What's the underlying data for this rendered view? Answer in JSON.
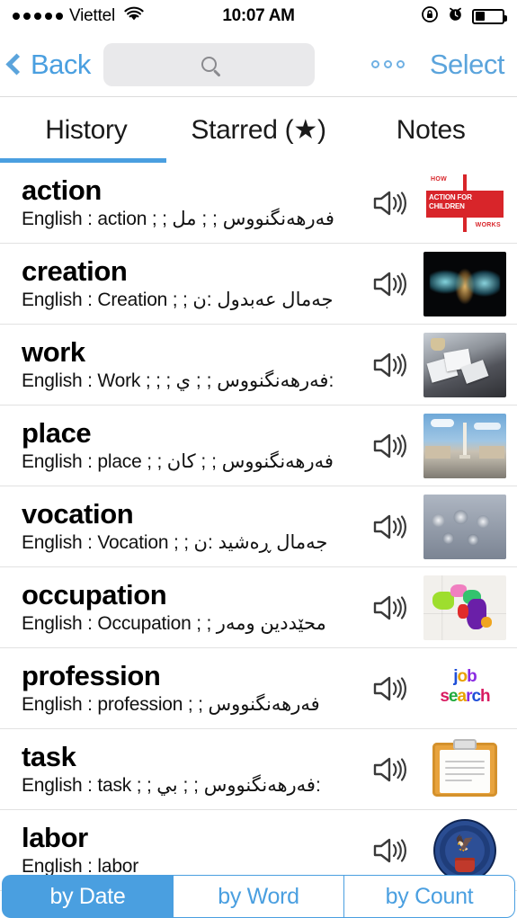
{
  "statusbar": {
    "carrier": "Viettel",
    "time": "10:07 AM",
    "signal_dots": 5,
    "wifi_icon": "wifi-icon",
    "rotation_lock_icon": "rotation-lock-icon",
    "alarm_icon": "alarm-clock-icon",
    "battery_icon": "battery-icon",
    "battery_percent": 35
  },
  "navbar": {
    "back_label": "Back",
    "back_icon": "chevron-left-icon",
    "search_placeholder": "",
    "search_value": "",
    "search_icon": "search-icon",
    "more_icon": "more-options-icon",
    "select_label": "Select"
  },
  "tabs": {
    "items": [
      {
        "label": "History",
        "active": true
      },
      {
        "label": "Starred (★)",
        "active": false
      },
      {
        "label": "Notes",
        "active": false
      }
    ]
  },
  "list": {
    "rows": [
      {
        "word": "action",
        "meaning": "English : action ;  ; فەرهەنگنووس ;  ; مل",
        "speaker_icon": "speaker-icon",
        "thumb": "how-action-for-children-works-logo",
        "thumb_text": {
          "line1": "HOW",
          "line2": "ACTION FOR CHILDREN",
          "line3": "WORKS"
        }
      },
      {
        "word": "creation",
        "meaning": "English : Creation ;  ; جەمال عەبدول :ن",
        "speaker_icon": "speaker-icon",
        "thumb": "creation-explosion-photo"
      },
      {
        "word": "work",
        "meaning": "English : Work ;  ;  ; فەرهەنگنووس ;  ; ي:",
        "speaker_icon": "speaker-icon",
        "thumb": "desk-papers-photo"
      },
      {
        "word": "place",
        "meaning": "English : place ;  ; فەرهەنگنووس ;  ; کان",
        "speaker_icon": "speaker-icon",
        "thumb": "heroes-square-monument-photo"
      },
      {
        "word": "vocation",
        "meaning": "English : Vocation ;  ; جەمال ڕەشید :ن",
        "speaker_icon": "speaker-icon",
        "thumb": "stone-relief-sculpture-photo"
      },
      {
        "word": "occupation",
        "meaning": "English : Occupation ;  ; محێددین ومەر",
        "speaker_icon": "speaker-icon",
        "thumb": "colored-region-map-image"
      },
      {
        "word": "profession",
        "meaning": "English : profession  ;  ; فەرهەنگنووس",
        "speaker_icon": "speaker-icon",
        "thumb": "job-search-colorful-text",
        "thumb_text": {
          "line1": "job",
          "line2": "search"
        }
      },
      {
        "word": "task",
        "meaning": "English : task ;  ; فەرهەنگنووس ;  ; بي:",
        "speaker_icon": "speaker-icon",
        "thumb": "clipboard-icon-image"
      },
      {
        "word": "labor",
        "meaning": "English : labor",
        "speaker_icon": "speaker-icon",
        "thumb": "department-of-labor-seal"
      }
    ]
  },
  "segmented": {
    "items": [
      {
        "label": "by Date",
        "active": true
      },
      {
        "label": "by Word",
        "active": false
      },
      {
        "label": "by Count",
        "active": false
      }
    ]
  },
  "colors": {
    "accent_blue": "#4A9FE0",
    "link_blue": "#5BA4DC",
    "separator": "#e2e2e2",
    "search_bg": "#e9e9eb"
  }
}
